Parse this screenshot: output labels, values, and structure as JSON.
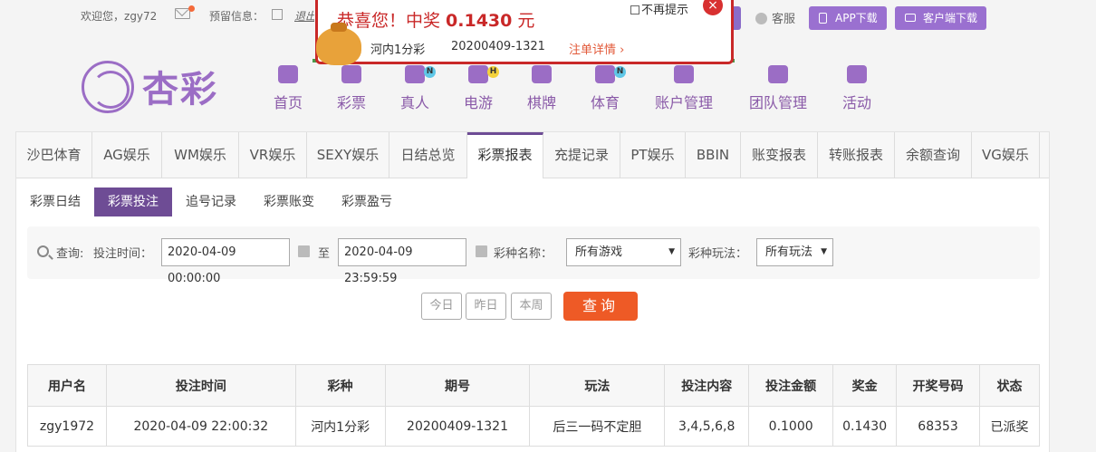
{
  "topbar": {
    "welcome": "欢迎您，",
    "username": "zgy72",
    "reserve_label": "预留信息：",
    "logout_label": "退出",
    "service_label": "客服",
    "app_download": "APP下载",
    "client_download": "客户端下载"
  },
  "logo": {
    "text": "杏彩"
  },
  "nav": {
    "items": [
      {
        "label": "首页",
        "icon": "home-icon"
      },
      {
        "label": "彩票",
        "icon": "lottery-icon"
      },
      {
        "label": "真人",
        "icon": "live-icon",
        "badge": "N"
      },
      {
        "label": "电游",
        "icon": "game-icon",
        "badge": "H"
      },
      {
        "label": "棋牌",
        "icon": "cards-icon"
      },
      {
        "label": "体育",
        "icon": "sports-icon",
        "badge": "N"
      },
      {
        "label": "账户管理",
        "icon": "account-icon"
      },
      {
        "label": "团队管理",
        "icon": "team-icon"
      },
      {
        "label": "活动",
        "icon": "gift-icon"
      }
    ]
  },
  "tabs": [
    {
      "label": "沙巴体育"
    },
    {
      "label": "AG娱乐"
    },
    {
      "label": "WM娱乐"
    },
    {
      "label": "VR娱乐"
    },
    {
      "label": "SEXY娱乐"
    },
    {
      "label": "日结总览"
    },
    {
      "label": "彩票报表",
      "active": true
    },
    {
      "label": "充提记录"
    },
    {
      "label": "PT娱乐"
    },
    {
      "label": "BBIN"
    },
    {
      "label": "账变报表"
    },
    {
      "label": "转账报表"
    },
    {
      "label": "余额查询"
    },
    {
      "label": "VG娱乐"
    }
  ],
  "subtabs": [
    {
      "label": "彩票日结"
    },
    {
      "label": "彩票投注",
      "active": true
    },
    {
      "label": "追号记录"
    },
    {
      "label": "彩票账变"
    },
    {
      "label": "彩票盈亏"
    }
  ],
  "filter": {
    "search_label": "查询:",
    "time_label": "投注时间：",
    "start_time": "2020-04-09 00:00:00",
    "to_label": "至",
    "end_time": "2020-04-09 23:59:59",
    "lottery_label": "彩种名称：",
    "lottery_value": "所有游戏",
    "play_label": "彩种玩法：",
    "play_value": "所有玩法"
  },
  "quick": {
    "today": "今日",
    "yesterday": "昨日",
    "week": "本周",
    "query": "查询"
  },
  "table": {
    "headers": [
      "用户名",
      "投注时间",
      "彩种",
      "期号",
      "玩法",
      "投注内容",
      "投注金额",
      "奖金",
      "开奖号码",
      "状态"
    ],
    "rows": [
      [
        "zgy1972",
        "2020-04-09 22:00:32",
        "河内1分彩",
        "20200409-1321",
        "后三一码不定胆",
        "3,4,5,6,8",
        "0.1000",
        "0.1430",
        "68353",
        "已派奖"
      ]
    ]
  },
  "popup": {
    "title_prefix": "恭喜您！中奖 ",
    "amount": "0.1430",
    "title_suffix": " 元",
    "lottery": "河内1分彩",
    "issue": "20200409-1321",
    "detail_link": "注单详情",
    "no_remind": "不再提示",
    "close": "×"
  },
  "colors": {
    "brand": "#6e4c95",
    "accent": "#ee5a26",
    "popup_red": "#c92828",
    "paid": "#e97a2a"
  }
}
